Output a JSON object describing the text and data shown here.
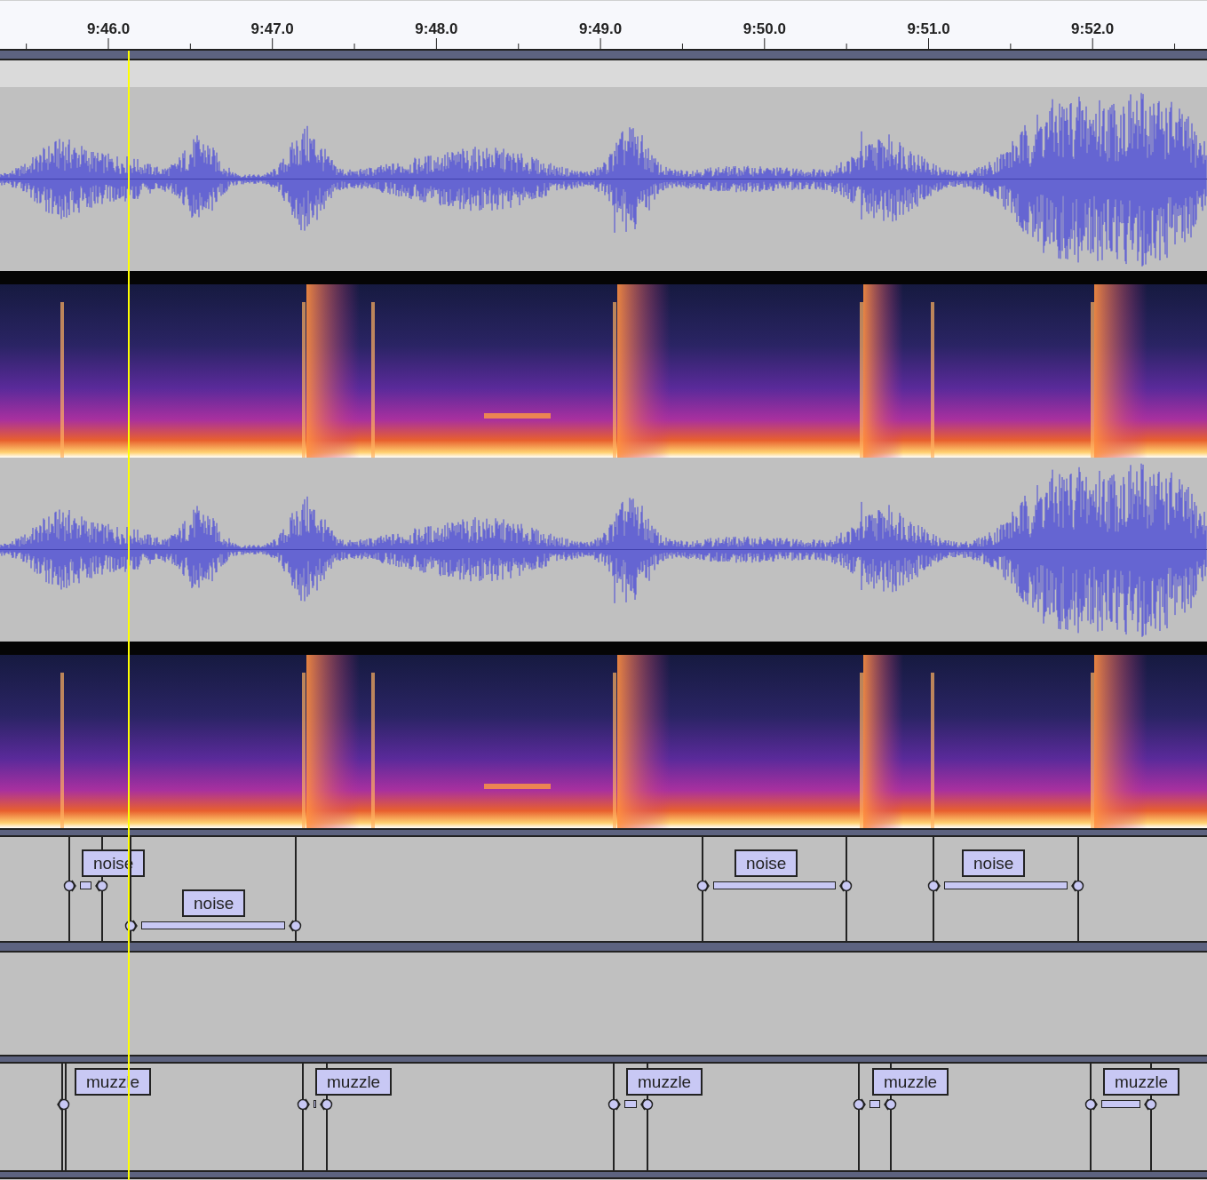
{
  "ruler": {
    "ticks": [
      "9:46.0",
      "9:47.0",
      "9:48.0",
      "9:49.0",
      "9:50.0",
      "9:51.0",
      "9:52.0"
    ]
  },
  "audio_tracks": [
    {
      "kind": "waveform"
    },
    {
      "kind": "spectrogram"
    },
    {
      "kind": "waveform"
    },
    {
      "kind": "spectrogram"
    }
  ],
  "label_tracks": [
    {
      "labels": [
        {
          "text": "noise"
        },
        {
          "text": "noise"
        },
        {
          "text": "noise"
        },
        {
          "text": "noise"
        }
      ]
    },
    {
      "labels": [
        {
          "text": "muzzle"
        },
        {
          "text": "muzzle"
        },
        {
          "text": "muzzle"
        },
        {
          "text": "muzzle"
        },
        {
          "text": "muzzle"
        }
      ]
    }
  ]
}
